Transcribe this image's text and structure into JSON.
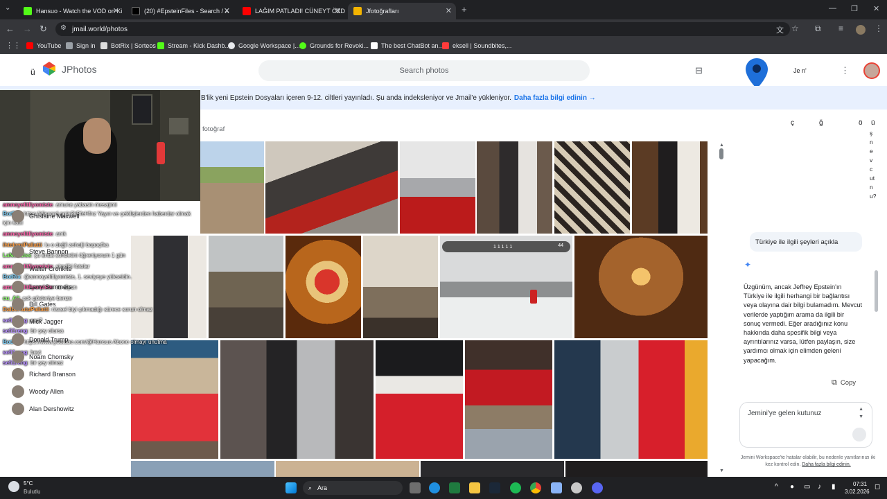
{
  "browser": {
    "tabs": [
      {
        "title": "Hansuo - Watch the VOD on Ki",
        "color": "#53fc18",
        "active": false
      },
      {
        "title": "(20) #EpsteinFiles - Search / X",
        "color": "#000000",
        "active": false
      },
      {
        "title": "LAĞIM PATLADI! CÜNEYT ÖZD",
        "color": "#ff0000",
        "active": false
      },
      {
        "title": "Jfotoğrafları",
        "color": "#f4b400",
        "active": true
      }
    ],
    "url": "jmail.world/photos",
    "bookmarks": [
      {
        "label": "YouTube",
        "color": "#ff0000"
      },
      {
        "label": "Sign in",
        "color": "#9aa0a6"
      },
      {
        "label": "BotRix | Sorteos",
        "color": "#ffffff"
      },
      {
        "label": "Stream - Kick Dashb...",
        "color": "#53fc18"
      },
      {
        "label": "Google Workspace |...",
        "color": "#e8eaed"
      },
      {
        "label": "Grounds for Revoki...",
        "color": "#53fc18"
      },
      {
        "label": "The best ChatBot an...",
        "color": "#ffffff"
      },
      {
        "label": "eksell | Soundbites,...",
        "color": "#ff3b3b"
      }
    ]
  },
  "app": {
    "brand": "JPhotos",
    "menu_char": "ü",
    "search_placeholder": "Search photos",
    "header_user_text": "Je n'",
    "banner_text": "B'lik yeni Epstein Dosyaları içeren 9-12. ciltleri yayınladı. Şu anda indeksleniyor ve Jmail'e yükleniyor.",
    "banner_link": "Daha fazla bilgi edinin →",
    "section_label": "fotoğraf",
    "photo_counter": "44",
    "photo_counter_digits": "1   1   1 1 1"
  },
  "people": [
    {
      "name": "Ghislaine Maxwell"
    },
    {
      "name": "Steve Bannon"
    },
    {
      "name": "Walter Cronkite"
    },
    {
      "name": "Larry Summers"
    },
    {
      "name": "Bill Gates"
    },
    {
      "name": "Mick Jagger"
    },
    {
      "name": "Donald Trump"
    },
    {
      "name": "Noam Chomsky"
    },
    {
      "name": "Richard Branson"
    },
    {
      "name": "Woody Allen"
    },
    {
      "name": "Alan Dershowitz"
    }
  ],
  "chat": [
    {
      "user": "amnoyelitliyomiste",
      "msg": ": amuna yabasin mesajimi"
    },
    {
      "user": "BotRix",
      "msg": ": https://discord.gg/a2kBfeHfnz Yayın ve çekilişlerden haberdar olmak"
    },
    {
      "user": "",
      "msg": "için katıl"
    },
    {
      "user": "amnoyelitliyomiste",
      "msg": ": amk"
    },
    {
      "user": "ihtelamiPallatti",
      "msg": ": lu o değil zehalji bapaçfka"
    },
    {
      "user": "LaNouuiss",
      "msg": ": şu anda sohbetini öğreniyorum 1 gün"
    },
    {
      "user": "amnoyelitliyomiste",
      "msg": ": şimdiki fotolar"
    },
    {
      "user": "BotRix",
      "msg": ": @amnoyelitliyomiste, 1. seviyeye yükseldin."
    },
    {
      "user": "amnoyelitliyomiste",
      "msg": ": ne diyon"
    },
    {
      "user": "cu_Ali",
      "msg": ": çok gösteriye benze"
    },
    {
      "user": "DalbeHutuPallatti",
      "msg": ": niwsel biyi çıkmadığı sürece sorun olmaz"
    },
    {
      "user": "sefi1reng",
      "msg": ": ses?"
    },
    {
      "user": "sefi1reng",
      "msg": ": bir şey olursa"
    },
    {
      "user": "BotRix",
      "msg": ": https://www.youtube.com/@Hansuo Abone olmayı unutma"
    },
    {
      "user": "sefi1reng",
      "msg": ": heyt"
    },
    {
      "user": "sefi1reng",
      "msg": ": bir şey olmaz"
    }
  ],
  "right_panel": {
    "letters": [
      "ç",
      "ğ",
      "ö",
      "ü"
    ],
    "vertical_text": "şnevcutnu?",
    "user_query": "Türkiye ile ilgili şeyleri açıkla",
    "answer": "Üzgünüm, ancak Jeffrey Epstein'ın Türkiye ile ilgili herhangi bir bağlantısı veya olayına dair bilgi bulamadım. Mevcut verilerde yaptığım arama da ilgili bir sonuç vermedi. Eğer aradığınız konu hakkında daha spesifik bilgi veya ayrıntılarınız varsa, lütfen paylaşın, size yardımcı olmak için elimden geleni yapacağım.",
    "copy_label": "Copy",
    "input_placeholder": "Jemini'ye gelen kutunuz",
    "footnote": "Jemini Workspace'te hatalar olabilir, bu nedenle yanıtlarınızı iki kez kontrol edin.",
    "footnote_link": "Daha fazla bilgi edinin."
  },
  "taskbar": {
    "weather_temp": "5°C",
    "weather_desc": "Bulutlu",
    "search_label": "Ara",
    "time": "07:31",
    "date": "3.02.2026"
  },
  "colors": {
    "accent": "#1a73e8",
    "banner_bg": "#e8f0fe",
    "chrome_dark": "#202124",
    "chrome_mid": "#35363a"
  }
}
